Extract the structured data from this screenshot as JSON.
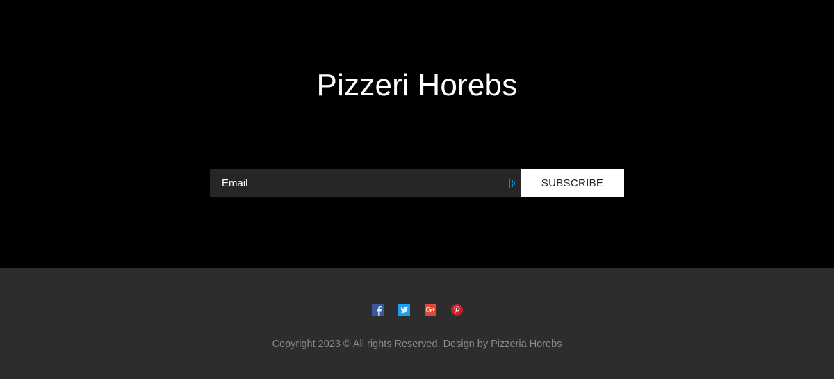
{
  "brand": {
    "title": "Pizzeri Horebs"
  },
  "subscribe": {
    "email_placeholder": "Email",
    "email_value": "",
    "button_label": "SUBSCRIBE"
  },
  "footer": {
    "social_icons": [
      "facebook-icon",
      "twitter-icon",
      "google-plus-icon",
      "pinterest-icon"
    ],
    "copyright": "Copyright 2023 © All rights Reserved. Design by Pizzeria Horebs"
  },
  "colors": {
    "top_background": "#000000",
    "footer_background": "#2d2d2d",
    "input_background": "#262626",
    "button_background": "#ffffff",
    "facebook": "#3b5998",
    "twitter": "#1da1f2",
    "google_plus": "#dd4b39",
    "pinterest": "#cb2027"
  }
}
